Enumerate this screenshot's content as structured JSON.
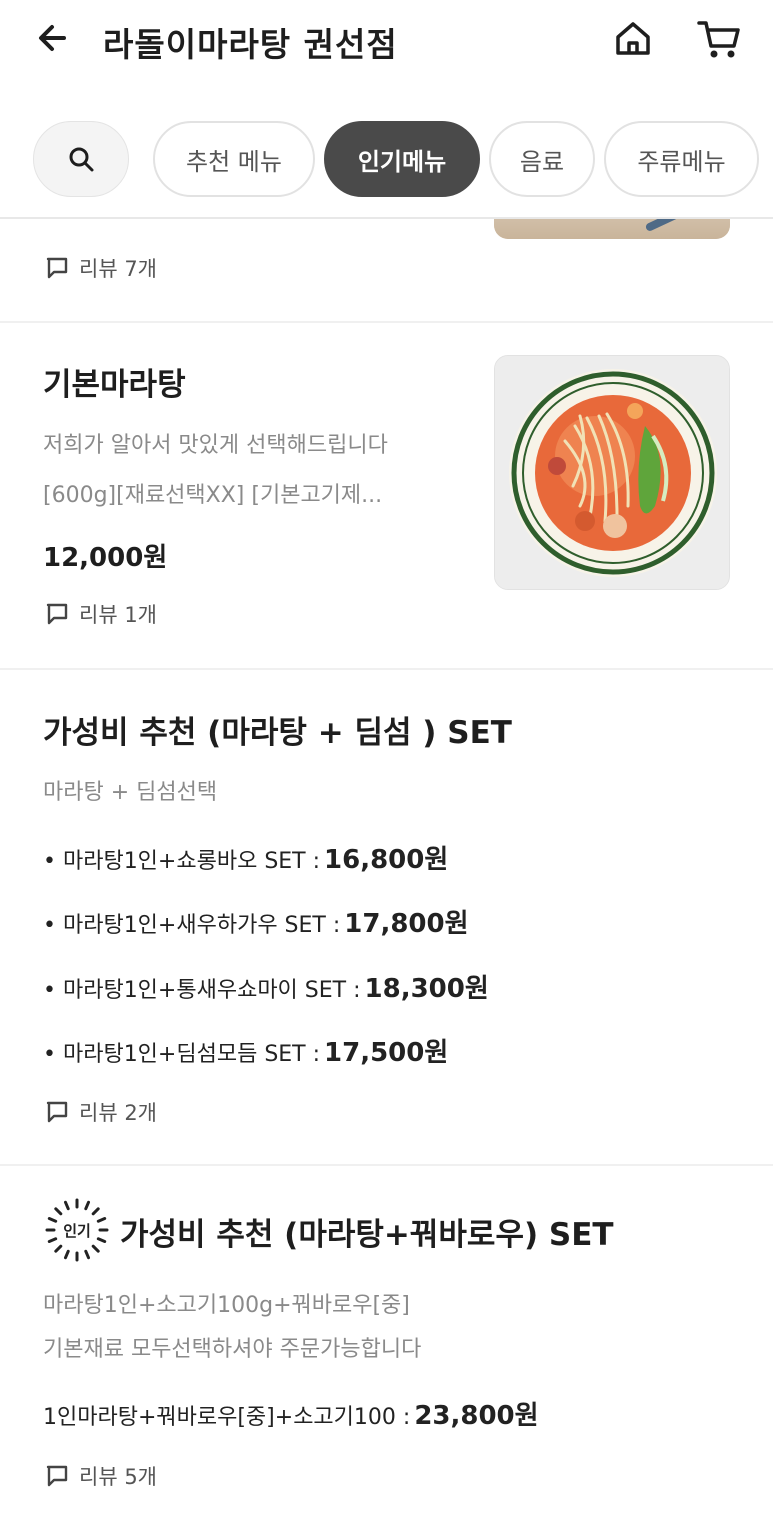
{
  "header": {
    "title": "라돌이마라탕 권선점"
  },
  "tabs": [
    {
      "label": "추천 메뉴",
      "active": false
    },
    {
      "label": "인기메뉴",
      "active": true
    },
    {
      "label": "음료",
      "active": false
    },
    {
      "label": "주류메뉴",
      "active": false
    }
  ],
  "icons": {
    "back": "back-arrow-icon",
    "home": "home-icon",
    "cart": "cart-icon",
    "search": "search-icon",
    "review": "comment-icon"
  },
  "items": [
    {
      "review": "리뷰 7개"
    },
    {
      "name": "기본마라탕",
      "desc_lines": [
        "저희가 알아서 맛있게 선택해드립니다",
        "[600g][재료선택XX] [기본고기제..."
      ],
      "price": "12,000원",
      "review": "리뷰 1개"
    },
    {
      "name": "가성비 추천 (마라탕 + 딤섬 ) SET",
      "desc": "마라탕 + 딤섬선택",
      "options": [
        {
          "label": "• 마라탕1인+쇼롱바오 SET :",
          "price": "16,800원"
        },
        {
          "label": "• 마라탕1인+새우하가우 SET :",
          "price": "17,800원"
        },
        {
          "label": "• 마라탕1인+통새우쇼마이 SET :",
          "price": "18,300원"
        },
        {
          "label": "• 마라탕1인+딤섬모듬 SET :",
          "price": "17,500원"
        }
      ],
      "review": "리뷰 2개"
    },
    {
      "badge": "인기",
      "name": "가성비 추천 (마라탕+꿔바로우) SET",
      "desc_lines": [
        "마라탕1인+소고기100g+꿔바로우[중]",
        "기본재료 모두선택하셔야 주문가능합니다"
      ],
      "option": {
        "label": "1인마라탕+꿔바로우[중]+소고기100 :",
        "price": "23,800원"
      },
      "review": "리뷰 5개"
    }
  ],
  "colors": {
    "active_tab": "#4a4a4a",
    "text": "#1e1e1e",
    "muted": "#8a8a8a"
  }
}
